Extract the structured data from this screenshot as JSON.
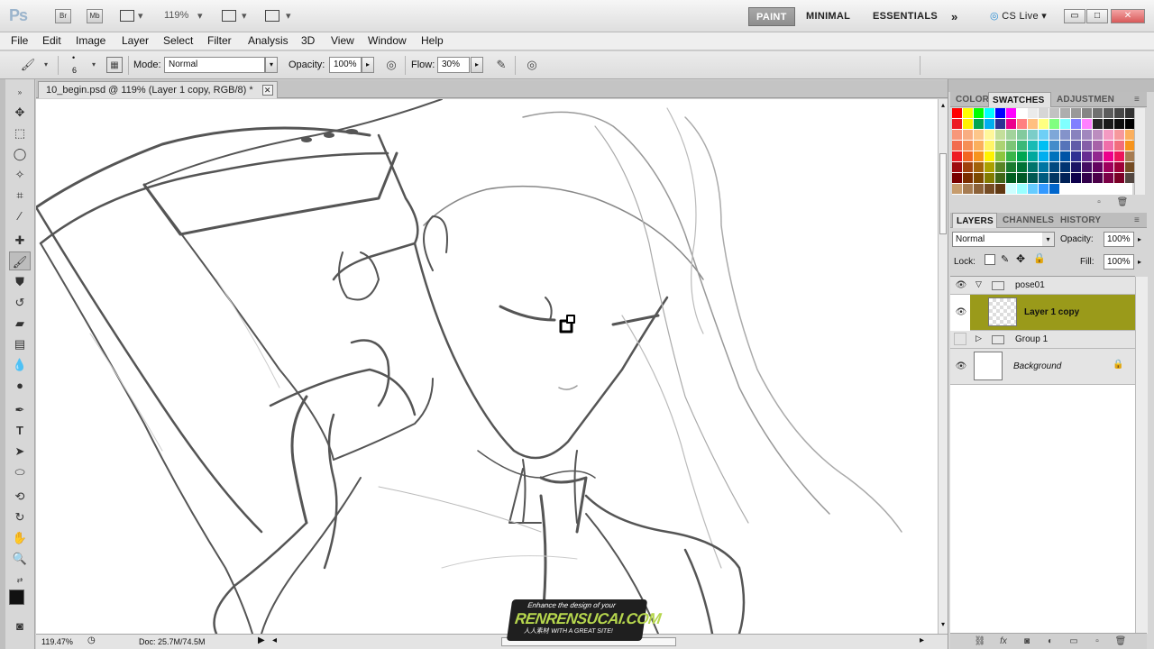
{
  "appbar": {
    "logo": "Ps",
    "bridge": "Br",
    "minibridge": "Mb",
    "zoom": "119%",
    "workspaces": [
      "PAINT",
      "MINIMAL",
      "ESSENTIALS"
    ],
    "more": "»",
    "cslive": "CS Live",
    "win_min": "▭",
    "win_max": "□",
    "win_close": "✕"
  },
  "menu": [
    "File",
    "Edit",
    "Image",
    "Layer",
    "Select",
    "Filter",
    "Analysis",
    "3D",
    "View",
    "Window",
    "Help"
  ],
  "options": {
    "brush_size": "6",
    "mode_label": "Mode:",
    "mode_value": "Normal",
    "opacity_label": "Opacity:",
    "opacity_value": "100%",
    "flow_label": "Flow:",
    "flow_value": "30%"
  },
  "document": {
    "tab_title": "10_begin.psd @ 119% (Layer 1 copy, RGB/8) *",
    "close": "✕"
  },
  "status": {
    "zoom": "119.47%",
    "doc": "Doc: 25.7M/74.5M"
  },
  "swatches_panel": {
    "tabs": [
      "COLOR",
      "SWATCHES",
      "ADJUSTMEN"
    ],
    "active_tab": "SWATCHES"
  },
  "layers_panel": {
    "tabs": [
      "LAYERS",
      "CHANNELS",
      "HISTORY"
    ],
    "blend_mode": "Normal",
    "opacity_label": "Opacity:",
    "opacity_value": "100%",
    "lock_label": "Lock:",
    "fill_label": "Fill:",
    "fill_value": "100%",
    "layers": [
      {
        "name": "pose01",
        "type": "group-open",
        "visible": true
      },
      {
        "name": "Layer 1 copy",
        "type": "layer",
        "visible": true,
        "selected": true
      },
      {
        "name": "Group 1",
        "type": "group-closed",
        "visible": false
      },
      {
        "name": "Background",
        "type": "background",
        "visible": true,
        "locked": true
      }
    ]
  },
  "watermark": {
    "top": "Enhance the design of your",
    "main": "RENRENSUCAI.COM",
    "sub": "人人素材  WITH A GREAT SITE!"
  },
  "colors": {
    "selected_layer": "#9a9a1a",
    "active_workspace": "#9a9a9a"
  }
}
